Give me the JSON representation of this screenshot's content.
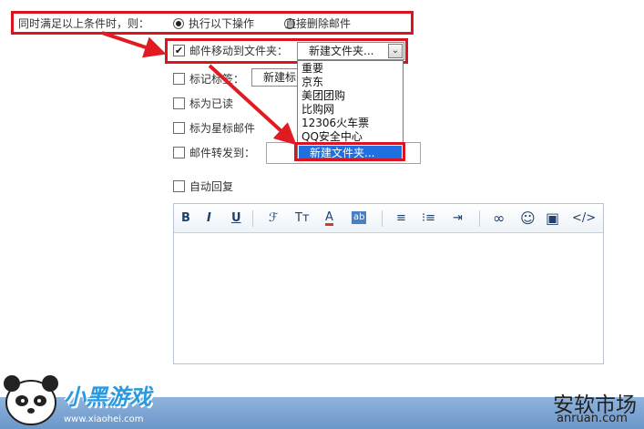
{
  "condition": {
    "label": "同时满足以上条件时，则：",
    "options": [
      {
        "label": "执行以下操作",
        "checked": true
      },
      {
        "label": "直接删除邮件",
        "checked": false
      }
    ]
  },
  "actions": {
    "move": {
      "label": "邮件移动到文件夹：",
      "checked": true,
      "selected": "新建文件夹..."
    },
    "tag": {
      "label": "标记标签：",
      "checked": false,
      "selected": "新建标"
    },
    "mark_read": {
      "label": "标为已读",
      "checked": false
    },
    "mark_star": {
      "label": "标为星标邮件",
      "checked": false
    },
    "forward": {
      "label": "邮件转发到：",
      "checked": false,
      "value": ""
    },
    "auto_reply": {
      "label": "自动回复",
      "checked": false
    }
  },
  "dropdown": {
    "options": [
      "重要",
      "京东",
      "美团团购",
      "比购网",
      "12306火车票",
      "QQ安全中心",
      "新建文件夹..."
    ],
    "highlighted": "新建文件夹..."
  },
  "editor": {
    "toolbar": [
      {
        "icon": "bold-icon",
        "glyph": "B"
      },
      {
        "icon": "italic-icon",
        "glyph": "I"
      },
      {
        "icon": "underline-icon",
        "glyph": "U"
      },
      {
        "icon": "font-family-icon",
        "glyph": "ℱ"
      },
      {
        "icon": "font-size-icon",
        "glyph": "Tт"
      },
      {
        "icon": "font-color-icon",
        "glyph": "A"
      },
      {
        "icon": "background-color-icon",
        "glyph": "ab"
      },
      {
        "icon": "align-icon",
        "glyph": "≡"
      },
      {
        "icon": "ordered-list-icon",
        "glyph": "⁝≡"
      },
      {
        "icon": "indent-icon",
        "glyph": "⇥"
      },
      {
        "icon": "link-icon",
        "glyph": "∞"
      },
      {
        "icon": "emoji-icon",
        "glyph": "☺"
      },
      {
        "icon": "image-icon",
        "glyph": "▣"
      },
      {
        "icon": "source-code-icon",
        "glyph": "</>"
      }
    ],
    "content": ""
  },
  "watermarks": {
    "left_brand": "小黑游戏",
    "left_url": "www.xiaohei.com",
    "right_brand": "安软市场",
    "right_url": "anruan.com"
  },
  "colors": {
    "highlight": "#d9141e",
    "selection": "#1e6fe0",
    "footer": "#7da6d4"
  }
}
